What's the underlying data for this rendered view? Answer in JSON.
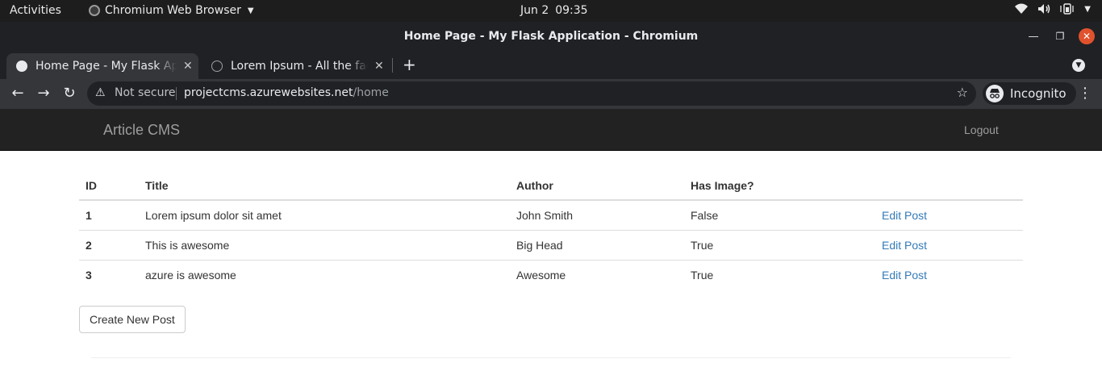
{
  "os_bar": {
    "activities": "Activities",
    "app_name": "Chromium Web Browser",
    "date": "Jun 2",
    "time": "09:35"
  },
  "window": {
    "title": "Home Page - My Flask Application - Chromium"
  },
  "tabs": [
    {
      "label": "Home Page - My Flask Application",
      "active": true
    },
    {
      "label": "Lorem Ipsum - All the facts",
      "active": false
    }
  ],
  "address_bar": {
    "security_label": "Not secure",
    "url_host": "projectcms.azurewebsites.net",
    "url_path": "/home",
    "profile_label": "Incognito"
  },
  "navbar": {
    "brand": "Article CMS",
    "logout": "Logout"
  },
  "table": {
    "headers": [
      "ID",
      "Title",
      "Author",
      "Has Image?",
      ""
    ],
    "rows": [
      {
        "id": "1",
        "title": "Lorem ipsum dolor sit amet",
        "author": "John Smith",
        "has_image": "False",
        "action": "Edit Post"
      },
      {
        "id": "2",
        "title": "This is awesome",
        "author": "Big Head",
        "has_image": "True",
        "action": "Edit Post"
      },
      {
        "id": "3",
        "title": "azure is awesome",
        "author": "Awesome",
        "has_image": "True",
        "action": "Edit Post"
      }
    ]
  },
  "create_button": "Create New Post",
  "colors": {
    "link": "#337ab7",
    "navbar_bg": "#222222",
    "close_button": "#e0522e"
  }
}
